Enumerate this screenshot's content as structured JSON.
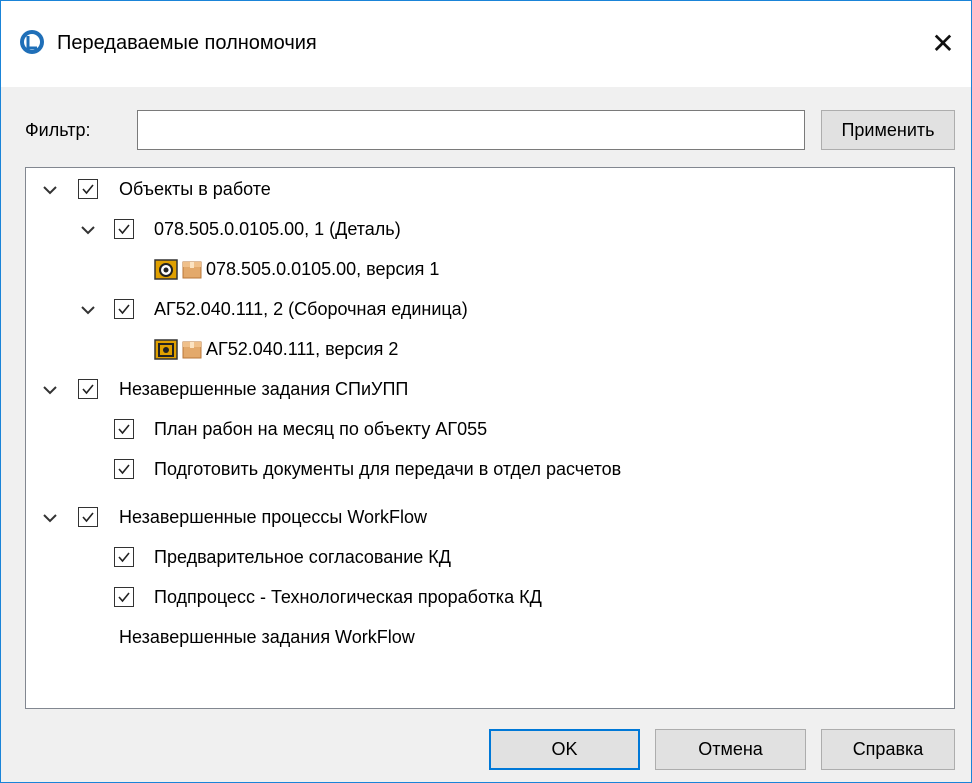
{
  "window": {
    "title": "Передаваемые полномочия",
    "close_label": "✕"
  },
  "filter": {
    "label": "Фильтр:",
    "value": "",
    "placeholder": "",
    "apply_label": "Применить"
  },
  "tree": {
    "groups": [
      {
        "label": "Объекты в работе",
        "items": [
          {
            "label": "078.505.0.0105.00, 1 (Деталь)",
            "child": "078.505.0.0105.00, версия 1"
          },
          {
            "label": "АГ52.040.111, 2 (Сборочная единица)",
            "child": "АГ52.040.111, версия 2"
          }
        ]
      },
      {
        "label": "Незавершенные задания СПиУПП",
        "items": [
          {
            "label": "План рабон на месяц по объекту АГ055"
          },
          {
            "label": "Подготовить документы для передачи в отдел расчетов"
          }
        ]
      },
      {
        "label": "Незавершенные процессы WorkFlow",
        "items": [
          {
            "label": "Предварительное согласование КД"
          },
          {
            "label": "Подпроцесс - Технологическая проработка КД"
          }
        ]
      },
      {
        "label": "Незавершенные задания WorkFlow"
      }
    ]
  },
  "footer": {
    "ok_label": "OK",
    "cancel_label": "Отмена",
    "help_label": "Справка"
  },
  "colors": {
    "accent": "#0078d7",
    "window_border": "#1a84d8",
    "dialog_bg": "#f0f0f0"
  }
}
